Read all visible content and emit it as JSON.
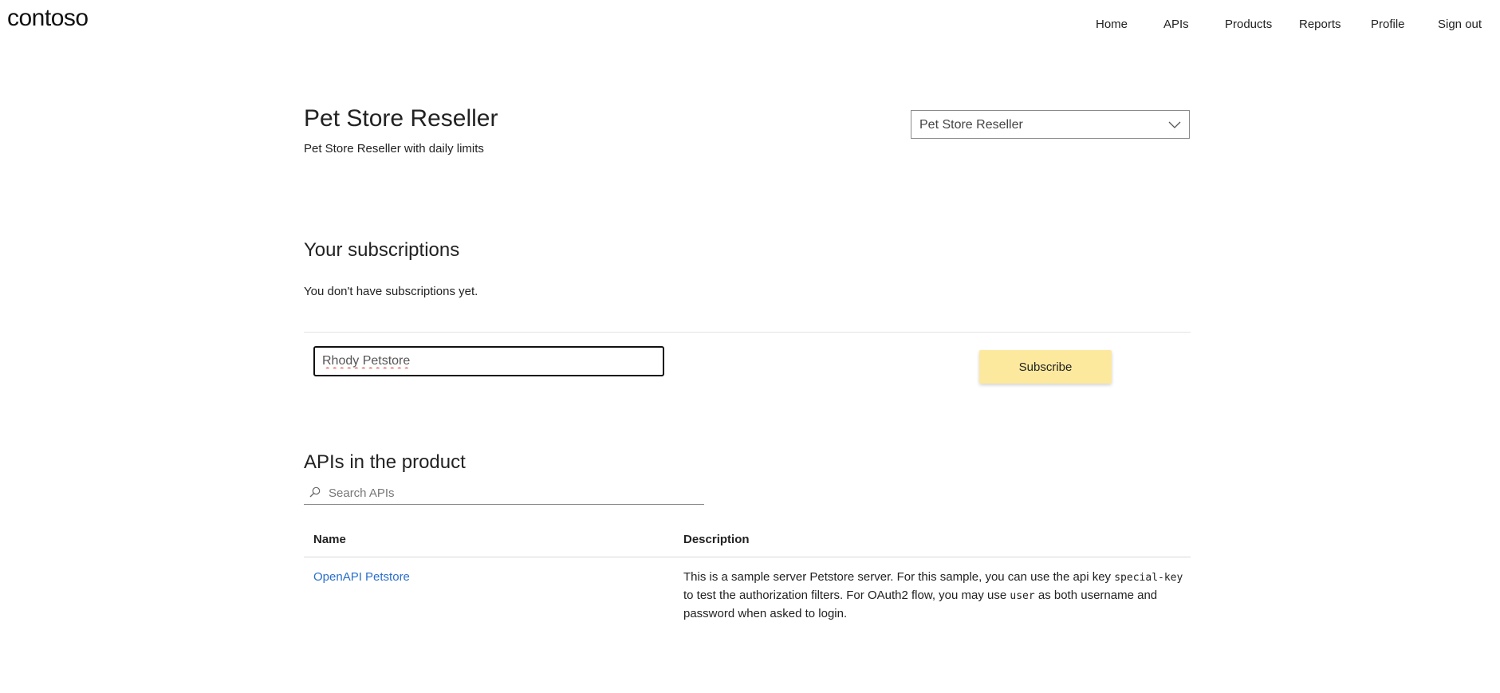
{
  "header": {
    "logo": "contoso",
    "nav": [
      {
        "label": "Home"
      },
      {
        "label": "APIs"
      },
      {
        "label": "Products"
      },
      {
        "label": "Reports"
      },
      {
        "label": "Profile"
      },
      {
        "label": "Sign out"
      }
    ]
  },
  "product": {
    "title": "Pet Store Reseller",
    "description": "Pet Store Reseller with daily limits",
    "selector_value": "Pet Store Reseller"
  },
  "subscriptions": {
    "title": "Your subscriptions",
    "empty_message": "You don't have subscriptions yet.",
    "new_subscription_value": "Rhody Petstore",
    "subscribe_label": "Subscribe"
  },
  "apis": {
    "title": "APIs in the product",
    "search_placeholder": "Search APIs",
    "columns": {
      "name": "Name",
      "description": "Description"
    },
    "rows": [
      {
        "name": "OpenAPI Petstore",
        "desc_1": "This is a sample server Petstore server. For this sample, you can use the api key ",
        "desc_code_1": "special-key",
        "desc_2": " to test the authorization filters. For OAuth2 flow, you may use ",
        "desc_code_2": "user",
        "desc_3": " as both username and password when asked to login."
      }
    ]
  },
  "colors": {
    "accent_button": "#fde99e",
    "link": "#2a6fc9"
  },
  "icons": {
    "dropdown": "chevron-down-icon",
    "search": "search-icon"
  }
}
